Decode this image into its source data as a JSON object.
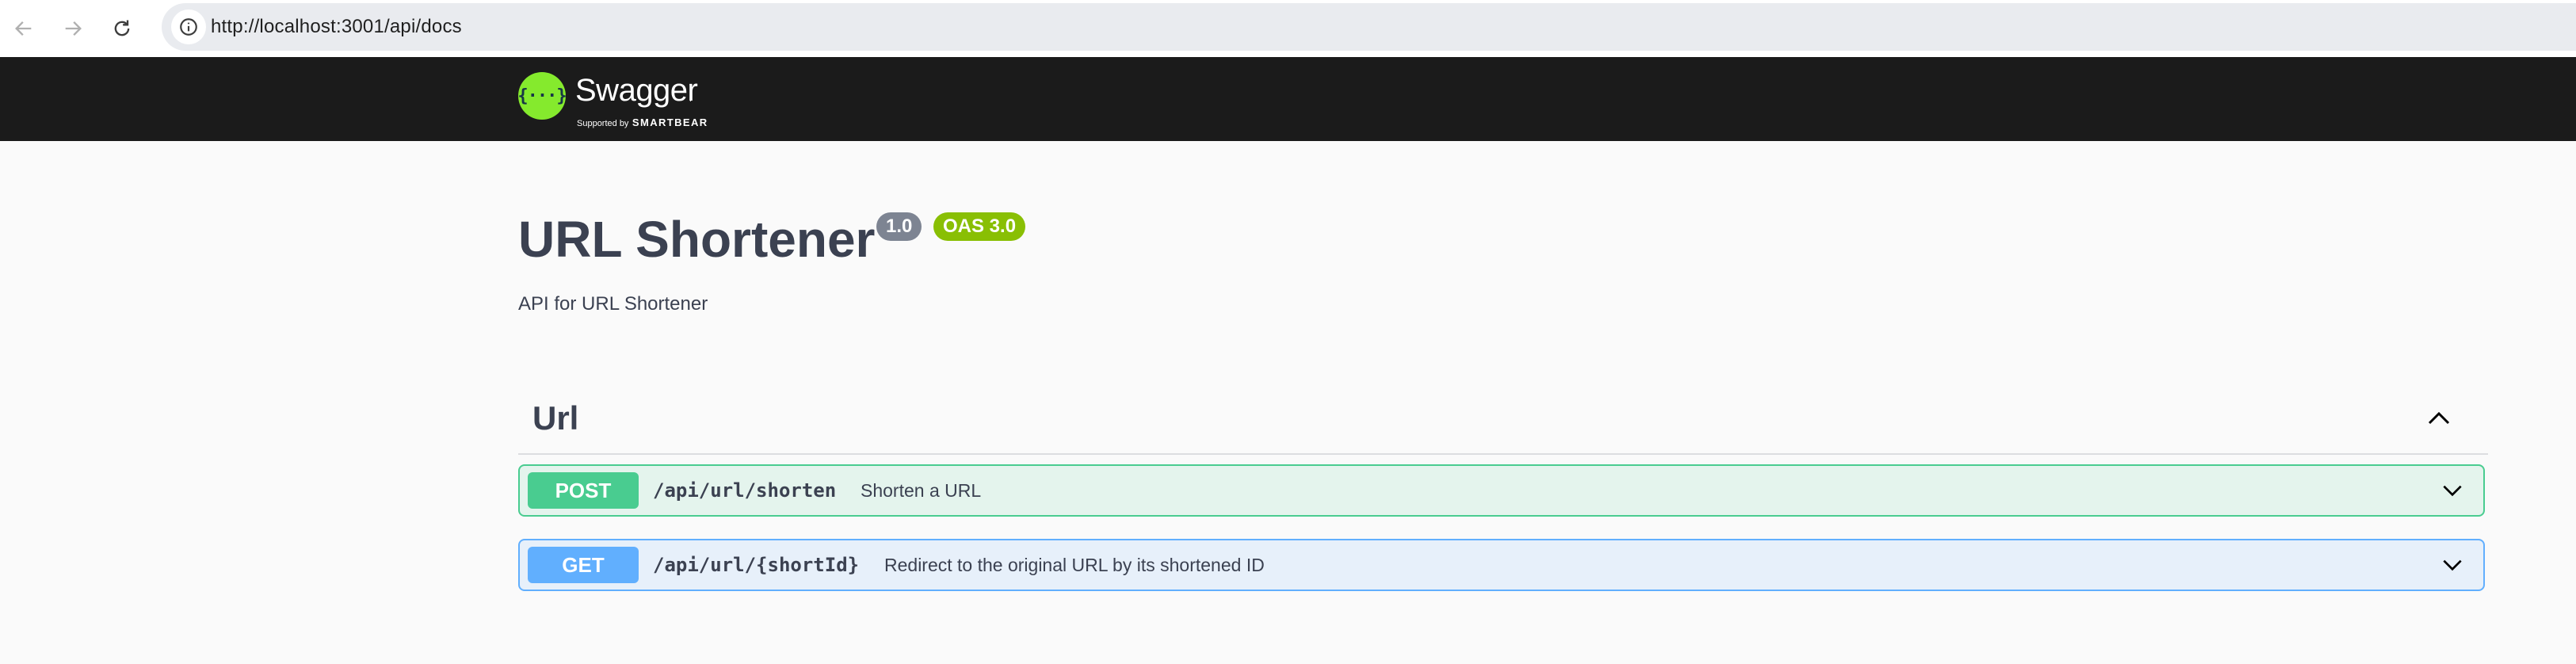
{
  "browser": {
    "url": "http://localhost:3001/api/docs",
    "icons": {
      "back": "arrow-left-icon",
      "forward": "arrow-right-icon",
      "reload": "reload-icon",
      "info": "info-icon"
    }
  },
  "topbar": {
    "logo_title": "Swagger",
    "logo_tm": ".",
    "supported_by": "Supported by",
    "brand": "SMARTBEAR",
    "logo_mark": "{···}"
  },
  "info": {
    "title": "URL Shortener",
    "version": "1.0",
    "oas": "OAS 3.0",
    "description": "API for URL Shortener"
  },
  "tags": [
    {
      "name": "Url",
      "expanded": true,
      "operations": [
        {
          "method": "POST",
          "path": "/api/url/shorten",
          "summary": "Shorten a URL",
          "color": "#49cc90"
        },
        {
          "method": "GET",
          "path": "/api/url/{shortId}",
          "summary": "Redirect to the original URL by its shortened ID",
          "color": "#61affe"
        }
      ]
    }
  ],
  "colors": {
    "topbar_bg": "#1b1b1b",
    "logo_green": "#85ea2d",
    "version_badge": "#7d8492",
    "oas_badge": "#89bf04",
    "post": "#49cc90",
    "get": "#61affe",
    "text": "#3b4151"
  }
}
